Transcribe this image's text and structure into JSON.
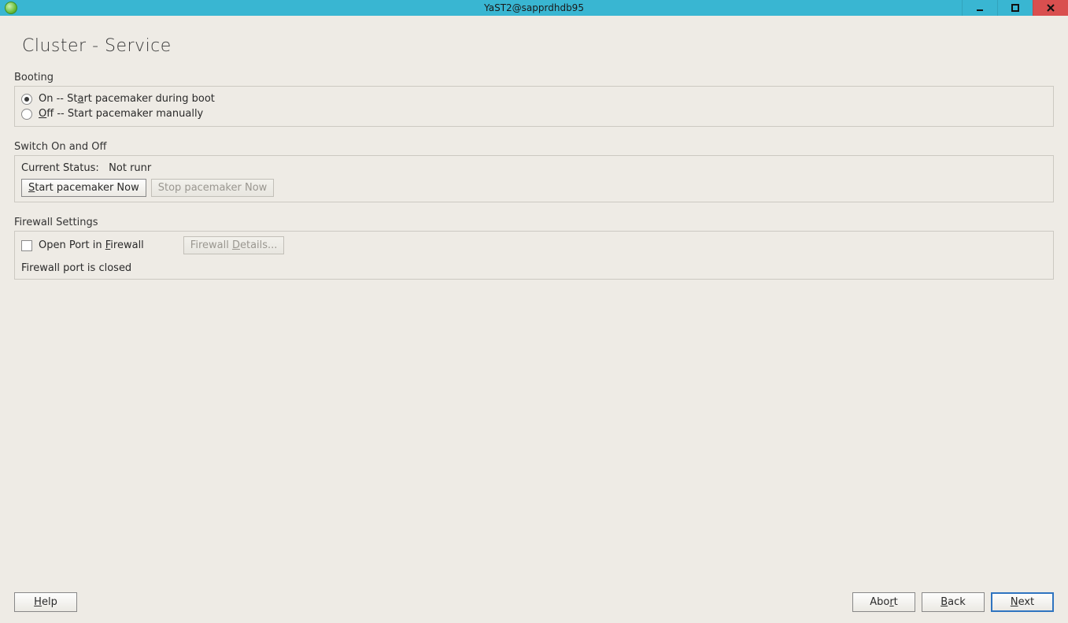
{
  "window": {
    "title": "YaST2@sapprdhdb95"
  },
  "page": {
    "title": "Cluster - Service"
  },
  "booting": {
    "label": "Booting",
    "option_on_prefix": "On -- St",
    "option_on_u": "a",
    "option_on_suffix": "rt pacemaker during boot",
    "option_off_u": "O",
    "option_off_suffix": "ff -- Start pacemaker manually",
    "selected": "on"
  },
  "switch": {
    "label": "Switch On and Off",
    "status_label": "Current Status: ",
    "status_value": "Not runr",
    "start_u": "S",
    "start_suffix": "tart pacemaker Now",
    "stop_label": "Stop pacemaker Now"
  },
  "firewall": {
    "label": "Firewall Settings",
    "open_port_prefix": "Open Port in ",
    "open_port_u": "F",
    "open_port_suffix": "irewall",
    "open_port_checked": false,
    "details_prefix": "Firewall ",
    "details_u": "D",
    "details_suffix": "etails...",
    "status": "Firewall port is closed"
  },
  "footer": {
    "help_u": "H",
    "help_suffix": "elp",
    "abort_prefix": "Abo",
    "abort_u": "r",
    "abort_suffix": "t",
    "back_u": "B",
    "back_suffix": "ack",
    "next_u": "N",
    "next_suffix": "ext"
  }
}
